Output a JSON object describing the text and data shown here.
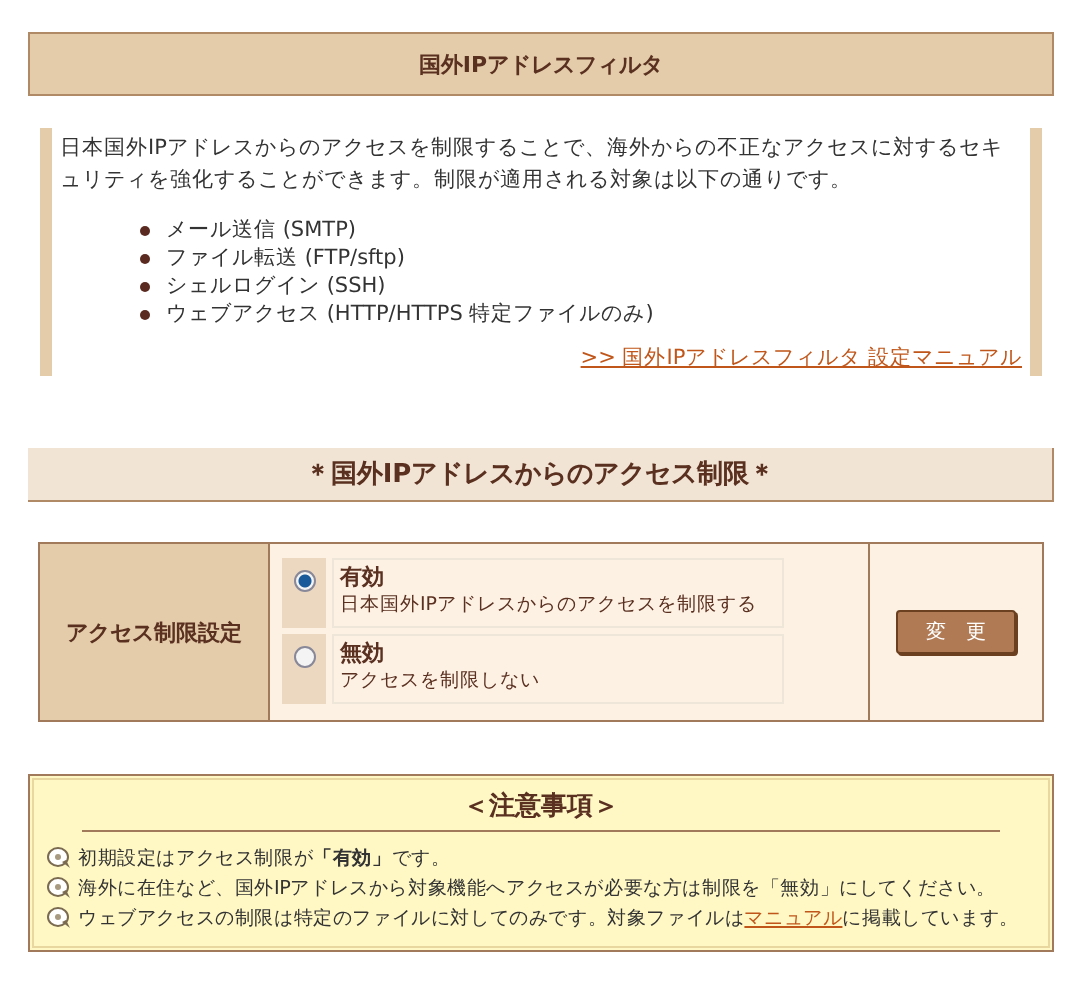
{
  "header": {
    "title": "国外IPアドレスフィルタ"
  },
  "intro": {
    "text": "日本国外IPアドレスからのアクセスを制限することで、海外からの不正なアクセスに対するセキュリティを強化することができます。制限が適用される対象は以下の通りです。",
    "items": [
      "メール送信 (SMTP)",
      "ファイル転送 (FTP/sftp)",
      "シェルログイン (SSH)",
      "ウェブアクセス (HTTP/HTTPS 特定ファイルのみ)"
    ],
    "link": ">> 国外IPアドレスフィルタ 設定マニュアル"
  },
  "section": {
    "title": "＊国外IPアドレスからのアクセス制限＊"
  },
  "setting": {
    "label": "アクセス制限設定",
    "options": [
      {
        "title": "有効",
        "description": "日本国外IPアドレスからのアクセスを制限する",
        "selected": true
      },
      {
        "title": "無効",
        "description": "アクセスを制限しない",
        "selected": false
      }
    ],
    "button": "変　更"
  },
  "notes": {
    "title": "＜注意事項＞",
    "items": [
      {
        "text": "初期設定はアクセス制限が**「有効」**です。"
      },
      {
        "text": "海外に在住など、国外IPアドレスから対象機能へアクセスが必要な方は制限を「無効」にしてください。"
      },
      {
        "text": "ウェブアクセスの制限は特定のファイルに対してのみです。対象ファイルは",
        "link": "マニュアル",
        "after": "に掲載しています。"
      }
    ]
  }
}
